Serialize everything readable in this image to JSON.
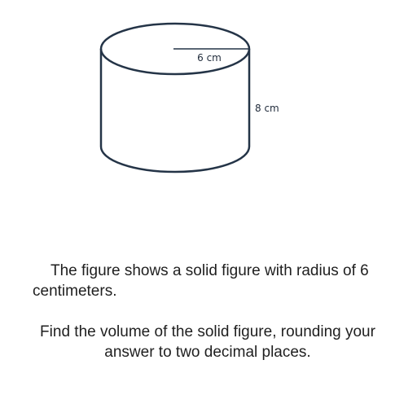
{
  "figure": {
    "shape": "cylinder",
    "stroke_color": "#243447",
    "radius_label": "6 cm",
    "height_label": "8 cm"
  },
  "problem": {
    "statement": "The figure shows a solid figure with radius of 6 centimeters.",
    "question": "Find the volume of the solid figure, rounding your answer to two decimal places."
  }
}
